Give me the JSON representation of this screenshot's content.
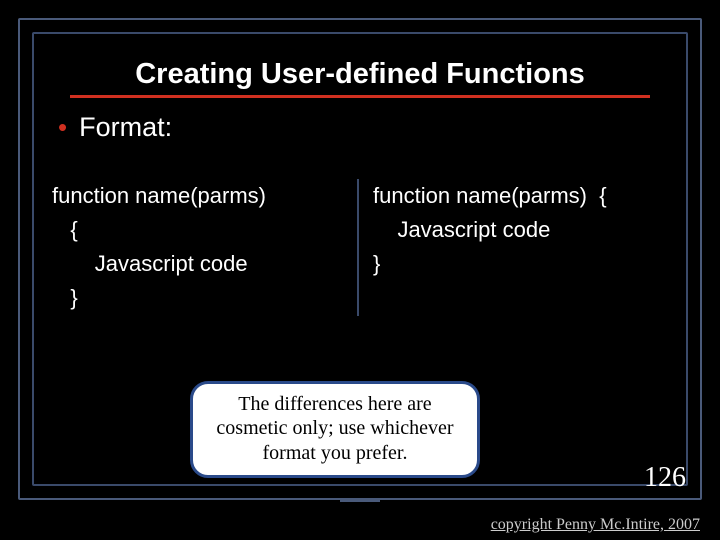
{
  "title": "Creating User-defined Functions",
  "bullet": "•",
  "bullet_text": "Format:",
  "code_left": "function name(parms)\n   {\n       Javascript code\n   }",
  "code_right": "function name(parms)  {\n    Javascript code\n}",
  "callout": "The differences here are cosmetic only; use whichever format you prefer.",
  "slide_number": "126",
  "copyright": "copyright Penny Mc.Intire, 2007"
}
